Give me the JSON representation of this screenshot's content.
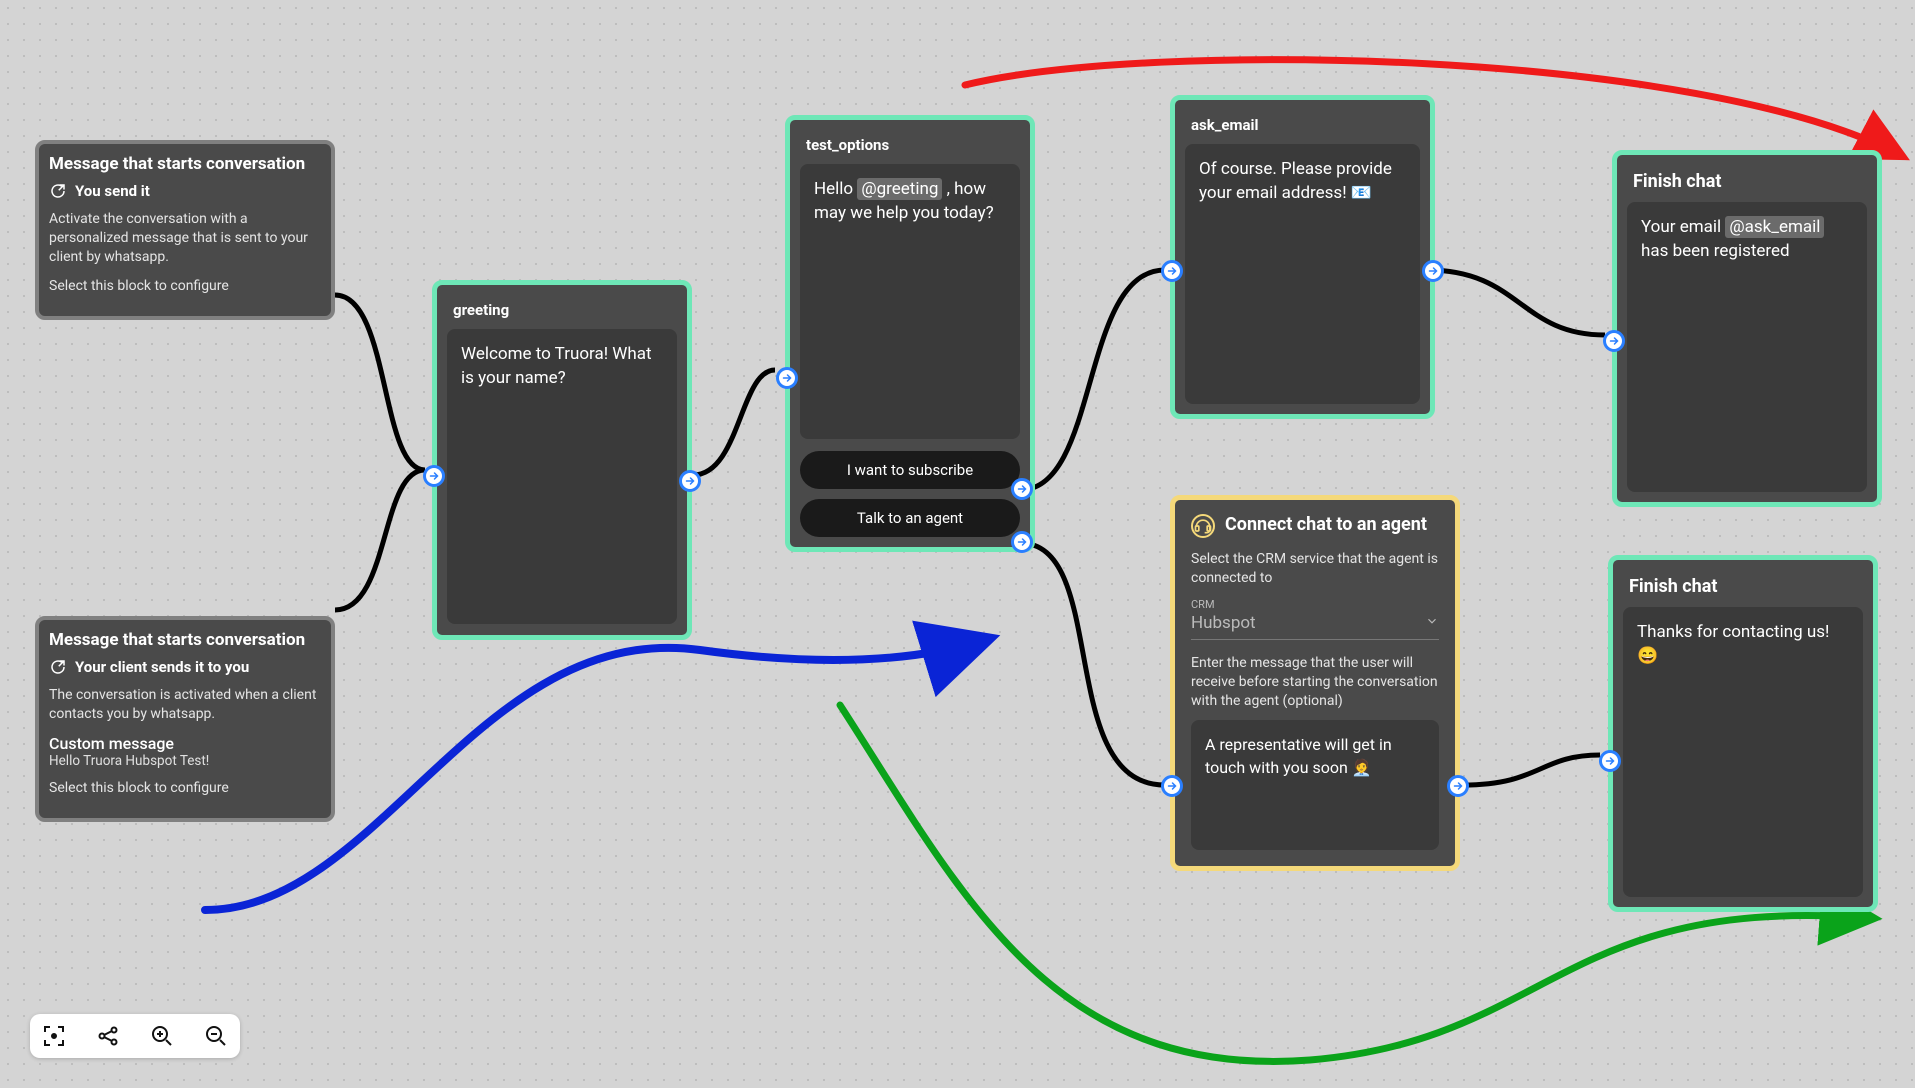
{
  "start1": {
    "title": "Message that starts conversation",
    "subtitle": "You send it",
    "desc": "Activate the conversation with a personalized message that is sent to your client by whatsapp.",
    "hint": "Select this block to configure"
  },
  "start2": {
    "title": "Message that starts conversation",
    "subtitle": "Your client sends it to you",
    "desc": "The conversation is activated when a client contacts you by whatsapp.",
    "custom_label": "Custom message",
    "custom_text": "Hello Truora Hubspot Test!",
    "hint": "Select this block to configure"
  },
  "greeting": {
    "name": "greeting",
    "text": "Welcome to Truora! What is your name?"
  },
  "test_options": {
    "name": "test_options",
    "text_pre": "Hello ",
    "tag": "@greeting",
    "text_post": " , how may we help you today?",
    "opt1": "I want to subscribe",
    "opt2": "Talk to an agent"
  },
  "ask_email": {
    "name": "ask_email",
    "text": "Of course. Please provide your email address! 📧"
  },
  "agent": {
    "title": "Connect chat to an agent",
    "p1": "Select the CRM service that the agent is connected to",
    "crm_label": "CRM",
    "crm_value": "Hubspot",
    "p2": "Enter the message that the user will receive before starting the conversation with the agent (optional)",
    "msg": "A representative will get in touch with you soon 🧑‍💼"
  },
  "finish1": {
    "name": "Finish chat",
    "text_pre": "Your email ",
    "tag": "@ask_email",
    "text_post": " has been registered"
  },
  "finish2": {
    "name": "Finish chat",
    "text": "Thanks for contacting us! 😄"
  },
  "toolbar": {
    "focus": "focus-icon",
    "share": "share-icon",
    "zoom_in": "zoom-in-icon",
    "zoom_out": "zoom-out-icon"
  }
}
